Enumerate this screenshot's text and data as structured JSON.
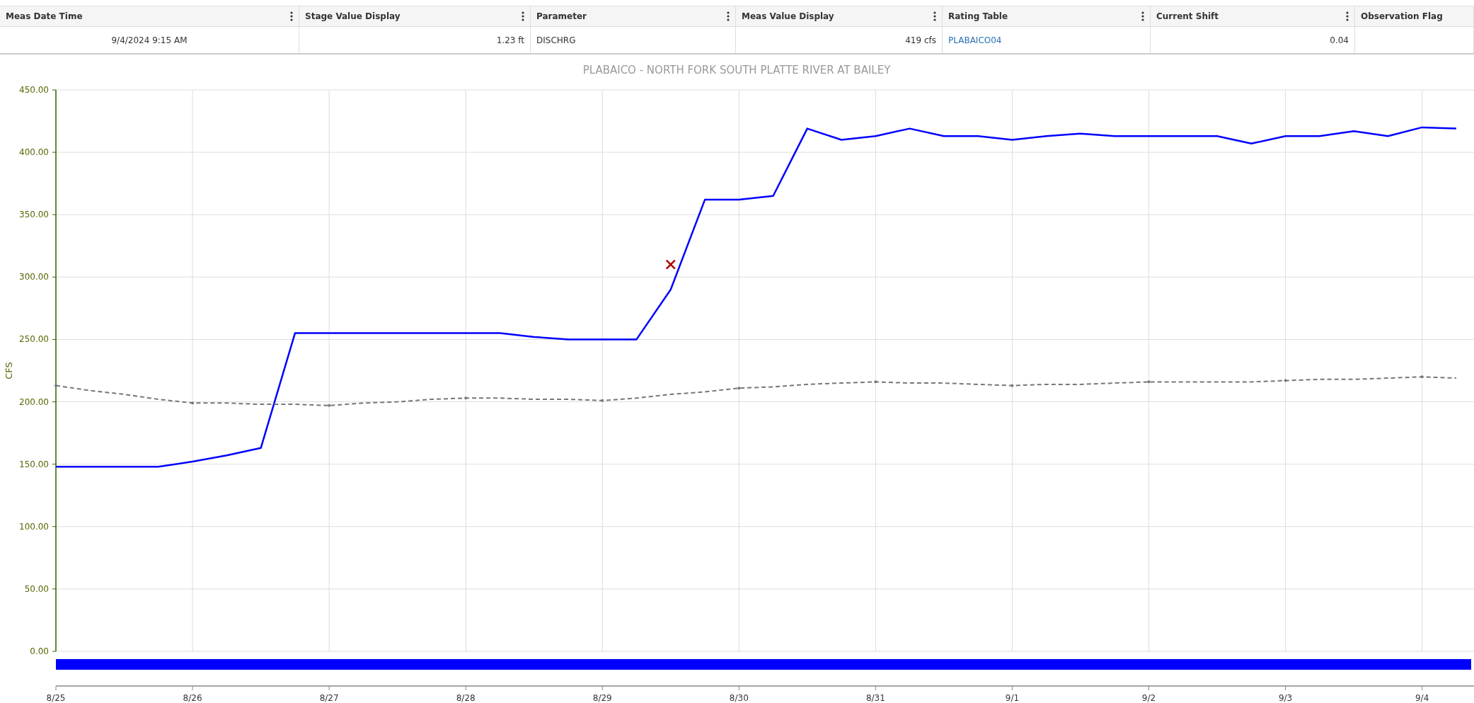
{
  "table": {
    "columns": [
      {
        "label": "Meas Date Time",
        "menu": true
      },
      {
        "label": "Stage Value Display",
        "menu": true
      },
      {
        "label": "Parameter",
        "menu": true
      },
      {
        "label": "Meas Value Display",
        "menu": true
      },
      {
        "label": "Rating Table",
        "menu": true
      },
      {
        "label": "Current Shift",
        "menu": true
      },
      {
        "label": "Observation Flag",
        "menu": false
      }
    ],
    "rows": [
      [
        {
          "text": "9/4/2024 9:15 AM",
          "kind": "text"
        },
        {
          "text": "1.23 ft",
          "kind": "text"
        },
        {
          "text": "DISCHRG",
          "kind": "text"
        },
        {
          "text": "419 cfs",
          "kind": "text"
        },
        {
          "text": "PLABAICO04",
          "kind": "link"
        },
        {
          "text": "0.04",
          "kind": "text"
        },
        {
          "text": "",
          "kind": "text"
        }
      ]
    ]
  },
  "chart": {
    "chart_data": {
      "type": "line",
      "title": "PLABAICO - NORTH FORK SOUTH PLATTE RIVER AT BAILEY",
      "ylabel": "CFS",
      "categories": [
        "8/25",
        null,
        null,
        null,
        "8/26",
        null,
        null,
        null,
        "8/27",
        null,
        null,
        null,
        "8/28",
        null,
        null,
        null,
        "8/29",
        null,
        null,
        null,
        "8/30",
        null,
        null,
        null,
        "8/31",
        null,
        null,
        null,
        "9/1",
        null,
        null,
        null,
        "9/2",
        null,
        null,
        null,
        "9/3",
        null,
        null,
        null,
        "9/4",
        null
      ],
      "series": [
        {
          "color": "#0000ff",
          "line_style": "solid",
          "values": [
            148,
            148,
            148,
            148,
            152,
            157,
            163,
            255,
            255,
            255,
            255,
            255,
            255,
            255,
            252,
            250,
            250,
            250,
            290,
            362,
            362,
            365,
            419,
            410,
            413,
            419,
            413,
            413,
            410,
            413,
            415,
            413,
            413,
            413,
            413,
            407,
            413,
            413,
            417,
            413,
            420,
            419
          ]
        },
        {
          "color": "#777777",
          "line_style": "dashed",
          "values": [
            213,
            209,
            206,
            202,
            199,
            199,
            198,
            198,
            197,
            199,
            200,
            202,
            203,
            203,
            202,
            202,
            201,
            203,
            206,
            208,
            211,
            212,
            214,
            215,
            216,
            215,
            215,
            214,
            213,
            214,
            214,
            215,
            216,
            216,
            216,
            216,
            217,
            218,
            218,
            219,
            220,
            219
          ]
        },
        {
          "color": "#b00000",
          "line_style": "none",
          "marker": "x",
          "values": [
            null,
            null,
            null,
            null,
            null,
            null,
            null,
            null,
            null,
            null,
            null,
            null,
            null,
            null,
            null,
            null,
            null,
            null,
            310,
            null,
            null,
            null,
            null,
            null,
            null,
            null,
            null,
            null,
            null,
            null,
            null,
            null,
            null,
            null,
            null,
            null,
            null,
            null,
            null,
            null,
            null,
            null
          ]
        }
      ],
      "grid": true,
      "ylim": [
        0,
        450
      ],
      "yticks": [
        {
          "value": 0,
          "label": "0.00"
        },
        {
          "value": 50,
          "label": "50.00"
        },
        {
          "value": 100,
          "label": "100.00"
        },
        {
          "value": 150,
          "label": "150.00"
        },
        {
          "value": 200,
          "label": "200.00"
        },
        {
          "value": 250,
          "label": "250.00"
        },
        {
          "value": 300,
          "label": "300.00"
        },
        {
          "value": 350,
          "label": "350.00"
        },
        {
          "value": 400,
          "label": "400.00"
        },
        {
          "value": 450,
          "label": "450.00"
        }
      ]
    }
  }
}
